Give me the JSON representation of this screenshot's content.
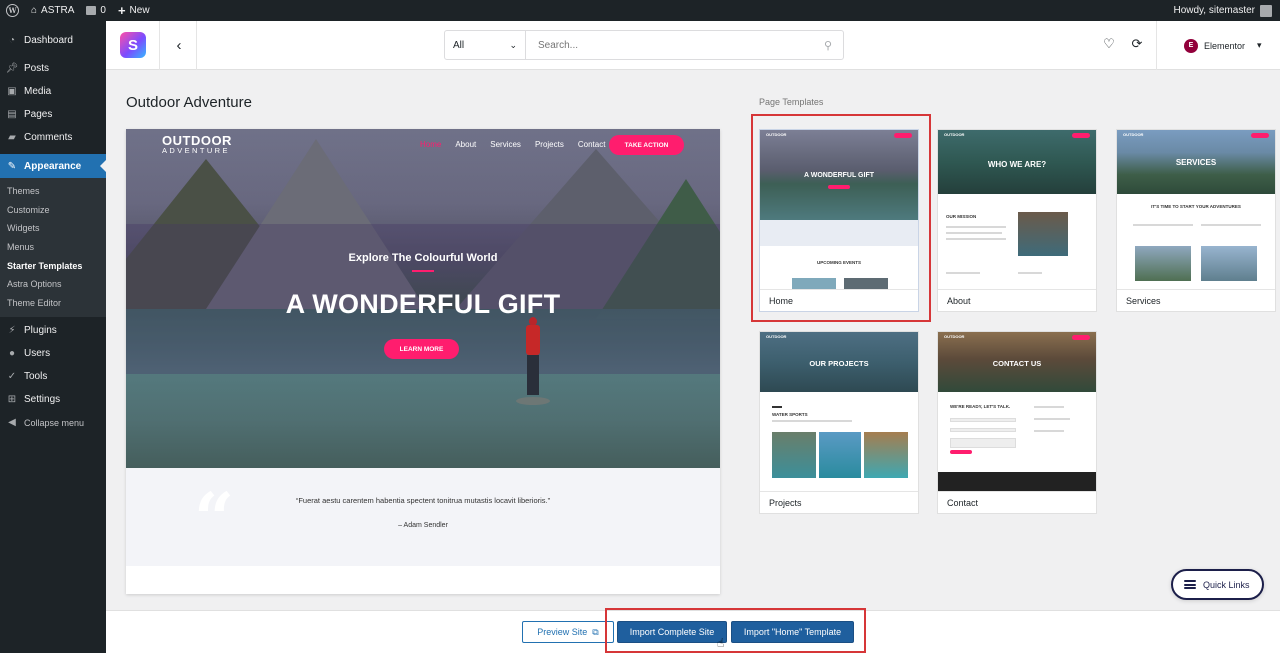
{
  "adminbar": {
    "site_name": "ASTRA",
    "comments_count": "0",
    "new_label": "New",
    "greeting": "Howdy, sitemaster"
  },
  "sidebar": {
    "items": [
      {
        "label": "Dashboard",
        "icon": "dashboard-icon"
      },
      {
        "label": "Posts",
        "icon": "pin-icon"
      },
      {
        "label": "Media",
        "icon": "media-icon"
      },
      {
        "label": "Pages",
        "icon": "pages-icon"
      },
      {
        "label": "Comments",
        "icon": "comment-icon"
      },
      {
        "label": "Appearance",
        "icon": "brush-icon"
      },
      {
        "label": "Plugins",
        "icon": "plug-icon"
      },
      {
        "label": "Users",
        "icon": "user-icon"
      },
      {
        "label": "Tools",
        "icon": "wrench-icon"
      },
      {
        "label": "Settings",
        "icon": "settings-icon"
      },
      {
        "label": "Collapse menu",
        "icon": "collapse-icon"
      }
    ],
    "appearance_sub": [
      "Themes",
      "Customize",
      "Widgets",
      "Menus",
      "Starter Templates",
      "Astra Options",
      "Theme Editor"
    ]
  },
  "topbar": {
    "filter_selected": "All",
    "search_placeholder": "Search...",
    "builder_label": "Elementor"
  },
  "preview": {
    "site_title": "Outdoor Adventure",
    "logo_line1": "OUTDOOR",
    "logo_line2": "ADVENTURE",
    "nav": [
      "Home",
      "About",
      "Services",
      "Projects",
      "Contact"
    ],
    "cta": "TAKE ACTION",
    "hero_sub": "Explore The Colourful World",
    "hero_title": "A WONDERFUL GIFT",
    "hero_button": "LEARN MORE",
    "quote": "“Fuerat aestu carentem habentia spectent tonitrua mutastis locavit liberioris.”",
    "quote_author": "– Adam Sendler"
  },
  "templates": {
    "label": "Page Templates",
    "items": [
      {
        "name": "Home",
        "title": "A WONDERFUL GIFT",
        "section": "UPCOMING EVENTS"
      },
      {
        "name": "About",
        "title": "WHO WE ARE?",
        "section": "OUR MISSION"
      },
      {
        "name": "Services",
        "title": "SERVICES",
        "section": "IT'S TIME TO START YOUR ADVENTURES"
      },
      {
        "name": "Projects",
        "title": "OUR PROJECTS",
        "section": "WATER SPORTS"
      },
      {
        "name": "Contact",
        "title": "CONTACT US",
        "section": "WE'RE READY, LET'S TALK."
      }
    ],
    "selected": "Home"
  },
  "quick_links": "Quick Links",
  "footer": {
    "preview_site": "Preview Site",
    "import_complete": "Import Complete Site",
    "import_template": "Import \"Home\" Template"
  },
  "colors": {
    "wp_dark": "#1d2327",
    "wp_blue": "#2271b1",
    "accent_pink": "#ff1d6e",
    "highlight_red": "#d63638"
  }
}
